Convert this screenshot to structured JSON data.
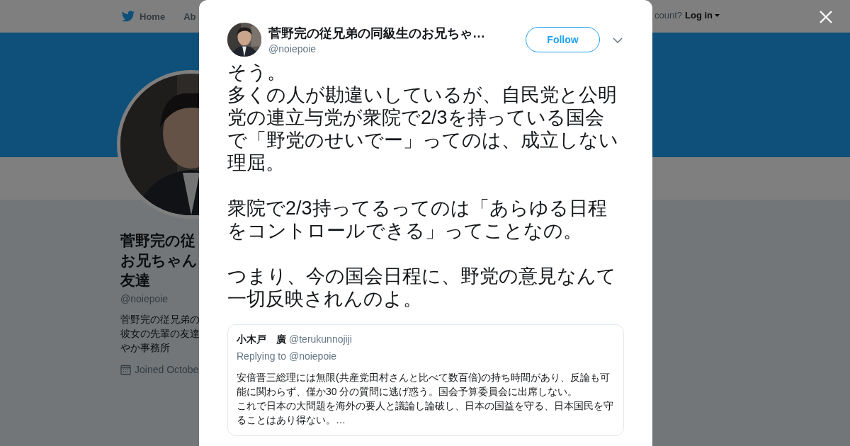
{
  "nav": {
    "home": "Home",
    "about": "Ab",
    "account_prompt": "count?",
    "login": "Log in"
  },
  "profile": {
    "name_lines": [
      "菅野完の従",
      "お兄ちゃん",
      "友達"
    ],
    "handle": "@noiepoie",
    "bio_lines": [
      "菅野完の従兄弟の",
      "彼女の先輩の友達",
      "やか事務所"
    ],
    "joined": "Joined Octobe"
  },
  "modal": {
    "author_name": "菅野完の従兄弟の同級生のお兄ちゃ…",
    "author_handle": "@noiepoie",
    "follow_button": "Follow",
    "tweet_paragraphs": [
      [
        "そう。",
        "多くの人が勘違いしているが、自民党と公明党の連立与党が衆院で2/3を持っている国会で「野党のせいでー」ってのは、成立しない理屈。"
      ],
      [
        "衆院で2/3持ってるってのは「あらゆる日程をコントロールできる」ってことなの。"
      ],
      [
        "つまり、今の国会日程に、野党の意見なんて一切反映されんのよ。"
      ]
    ],
    "quoted": {
      "name": "小木戸　廣",
      "handle": "@terukunnojiji",
      "replying_to": "Replying to @noiepoie",
      "text_lines": [
        "安倍晋三総理には無限(共産党田村さんと比べて数百倍)の持ち時間があり、反論も可能に関わらず、僅か30 分の質問に逃げ惑う。国会予算委員会に出席しない。",
        "これで日本の大問題を海外の要人と議論し論破し、日本の国益を守る、日本国民を守ることはあり得ない。…"
      ]
    }
  }
}
